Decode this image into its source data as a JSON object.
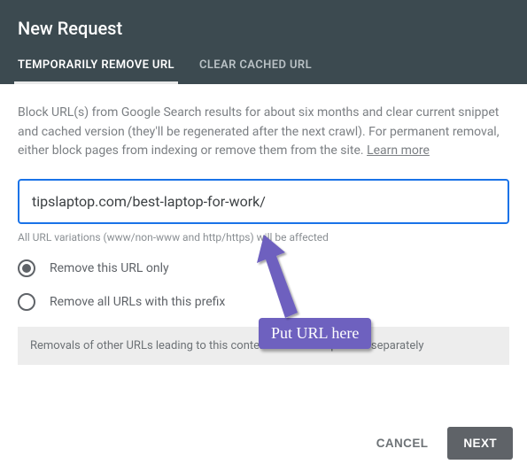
{
  "dialog": {
    "title": "New Request",
    "tabs": [
      {
        "label": "TEMPORARILY REMOVE URL"
      },
      {
        "label": "CLEAR CACHED URL"
      }
    ],
    "description": "Block URL(s) from Google Search results for about six months and clear current snippet and cached version (they'll be regenerated after the next crawl). For permanent removal, either block pages from indexing or remove them from the site. ",
    "learn_more": "Learn more",
    "url_value": "tipslaptop.com/best-laptop-for-work/",
    "url_hint": "All URL variations (www/non-www and http/https) will be affected",
    "radio_options": [
      {
        "label": "Remove this URL only"
      },
      {
        "label": "Remove all URLs with this prefix"
      }
    ],
    "notice": "Removals of other URLs leading to this content must be requested separately",
    "cancel_label": "CANCEL",
    "next_label": "NEXT"
  },
  "annotation": {
    "callout_text": "Put URL here"
  }
}
